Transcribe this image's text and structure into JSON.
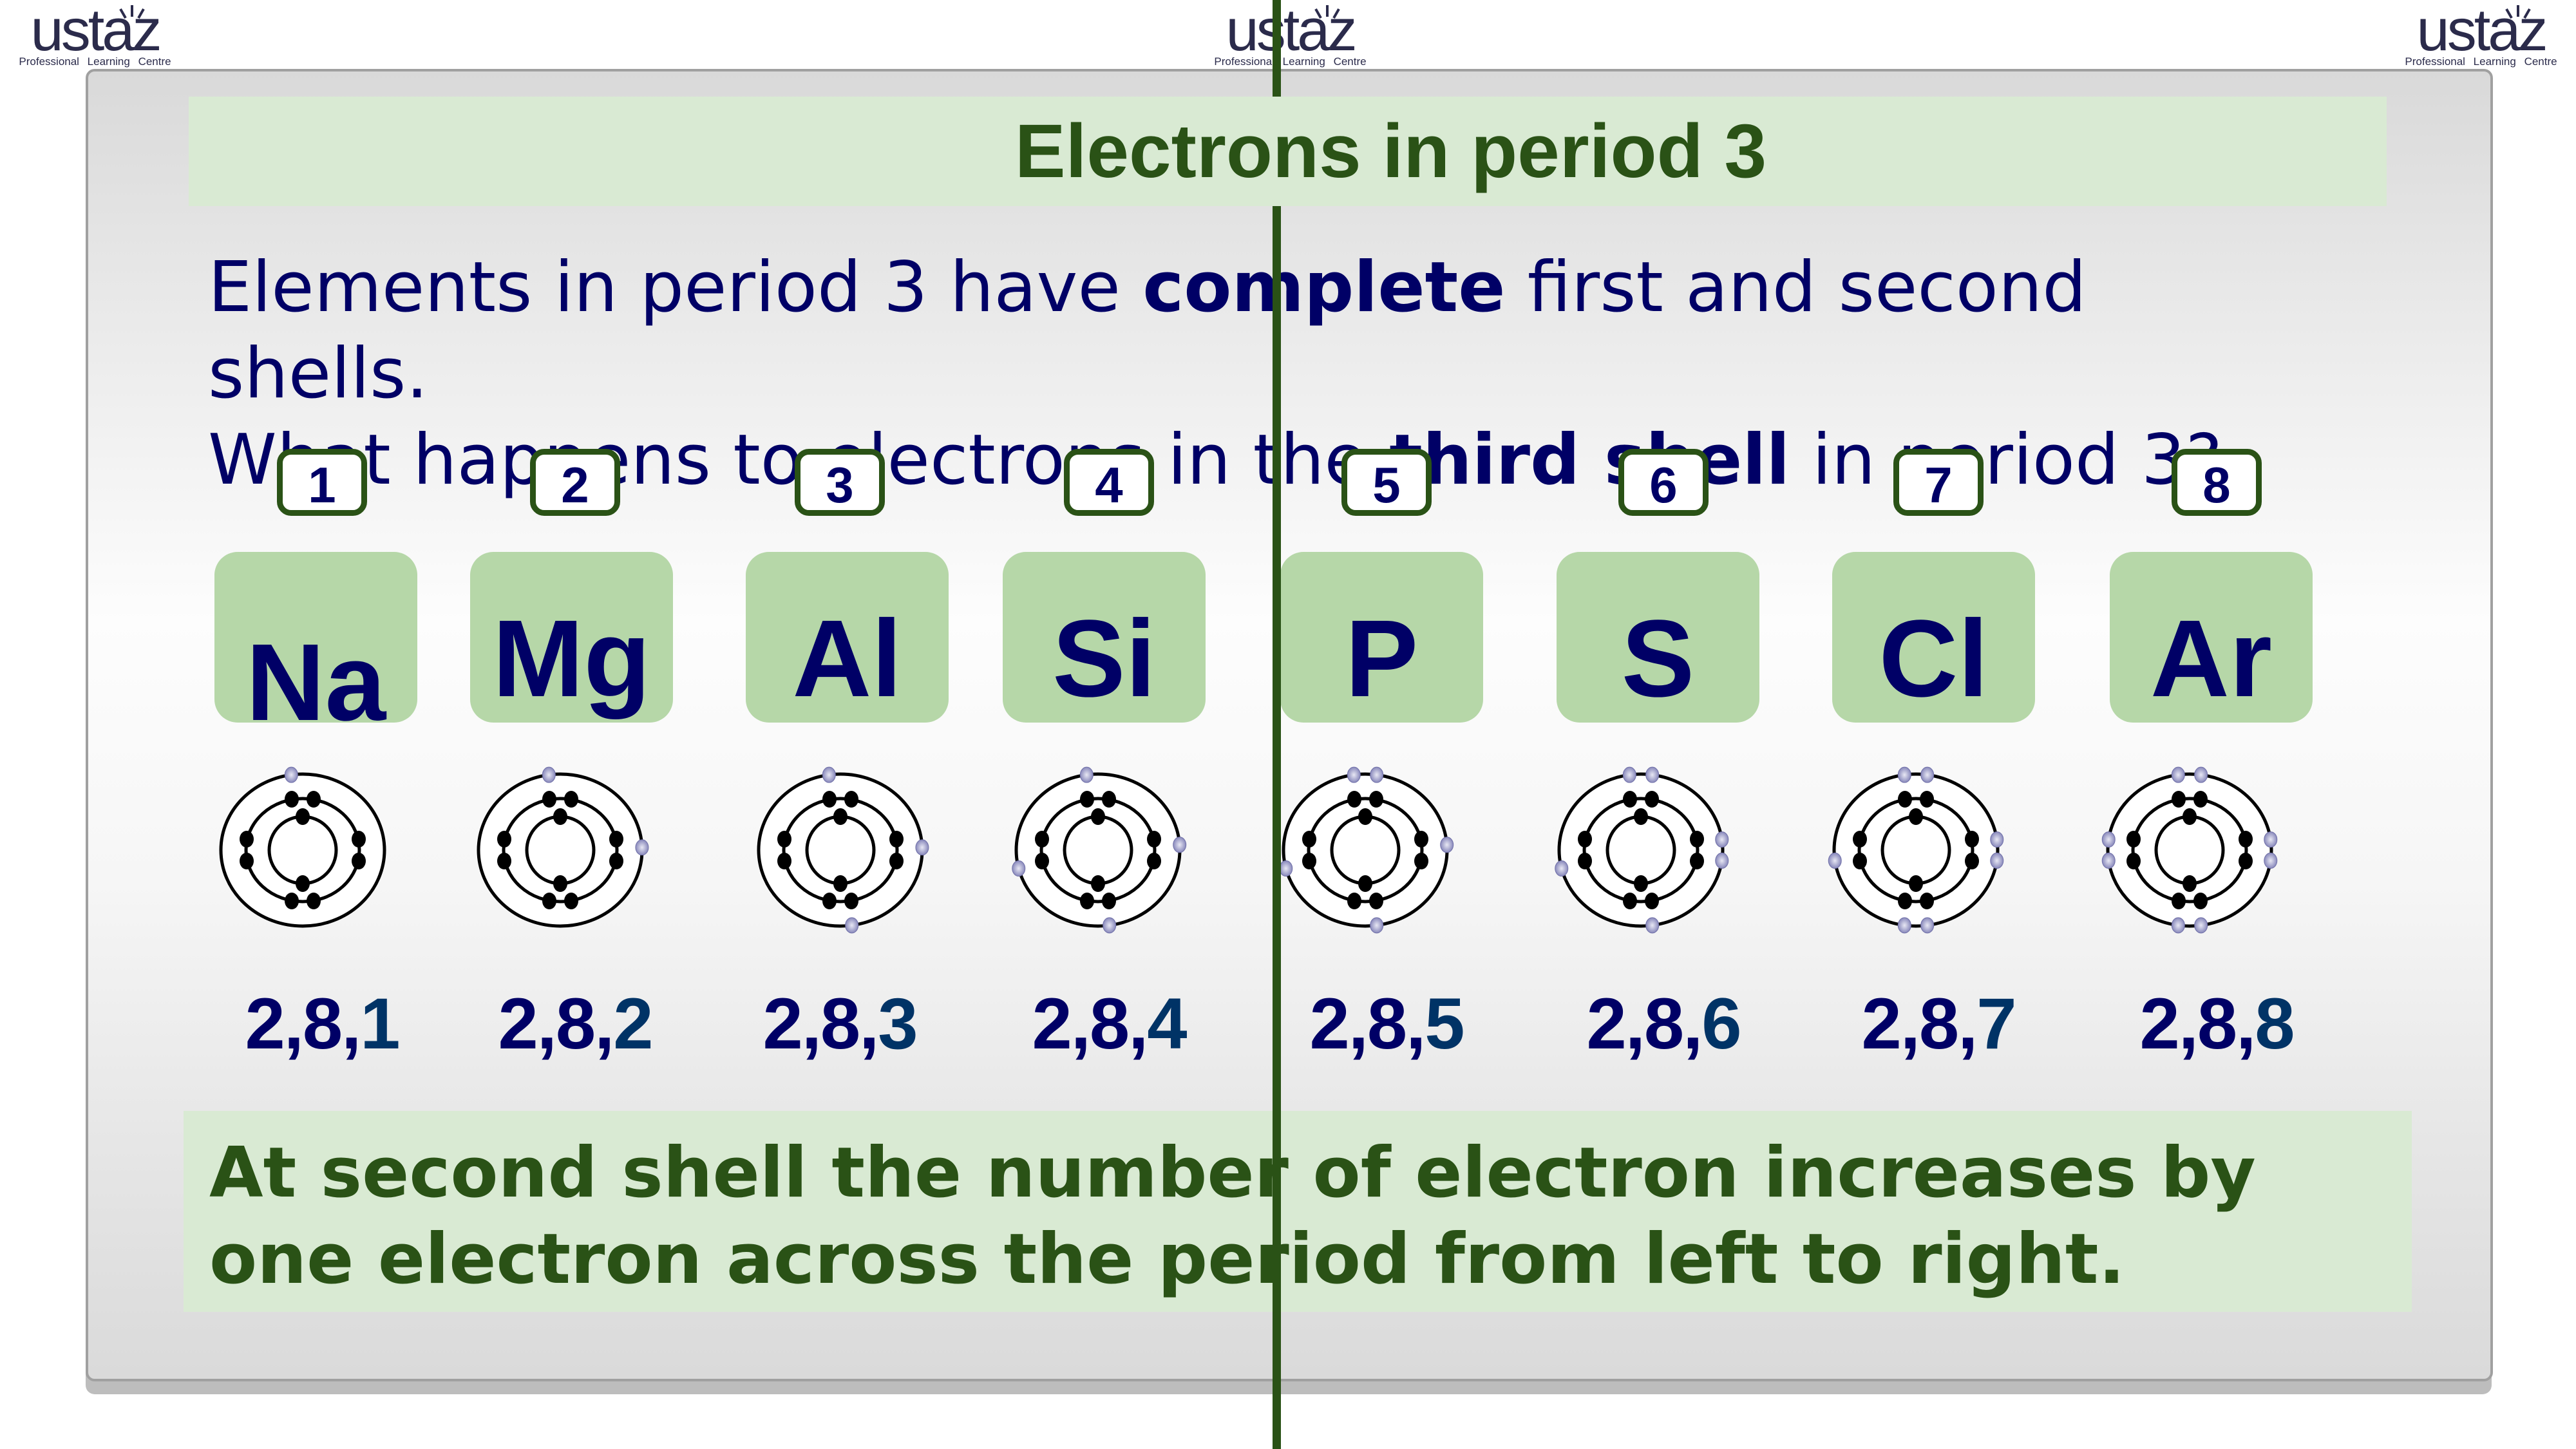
{
  "logo": {
    "wordmark": "ustaz",
    "tagline": "Professional Learning Centre",
    "color": "#2b2b4b"
  },
  "slide": {
    "title": "Electrons in period 3",
    "intro": {
      "line1_pre": "Elements in period 3 have ",
      "line1_bold": "complete",
      "line1_post": " first and second",
      "line2": "shells.",
      "line3_pre": "What happens to electrons in the ",
      "line3_bold": "third shell",
      "line3_post": " in period 3?"
    },
    "elements": [
      {
        "index": "1",
        "symbol": "Na",
        "config_prefix": "2,8,",
        "config_last": "1",
        "outer_electrons": 1
      },
      {
        "index": "2",
        "symbol": "Mg",
        "config_prefix": "2,8,",
        "config_last": "2",
        "outer_electrons": 2
      },
      {
        "index": "3",
        "symbol": "Al",
        "config_prefix": "2,8,",
        "config_last": "3",
        "outer_electrons": 3
      },
      {
        "index": "4",
        "symbol": "Si",
        "config_prefix": "2,8,",
        "config_last": "4",
        "outer_electrons": 4
      },
      {
        "index": "5",
        "symbol": "P",
        "config_prefix": "2,8,",
        "config_last": "5",
        "outer_electrons": 5
      },
      {
        "index": "6",
        "symbol": "S",
        "config_prefix": "2,8,",
        "config_last": "6",
        "outer_electrons": 6
      },
      {
        "index": "7",
        "symbol": "Cl",
        "config_prefix": "2,8,",
        "config_last": "7",
        "outer_electrons": 7
      },
      {
        "index": "8",
        "symbol": "Ar",
        "config_prefix": "2,8,",
        "config_last": "8",
        "outer_electrons": 8
      }
    ],
    "conclusion": "At second shell the number of electron increases by one electron across the period from left to right."
  },
  "colors": {
    "title_green": "#2a5216",
    "banner_bg": "#d9ead3",
    "element_box": "#b6d7a8",
    "text_navy": "#000066",
    "config_last": "#003366",
    "outer_electron": "#8888bb",
    "inner_electron": "#000000"
  }
}
